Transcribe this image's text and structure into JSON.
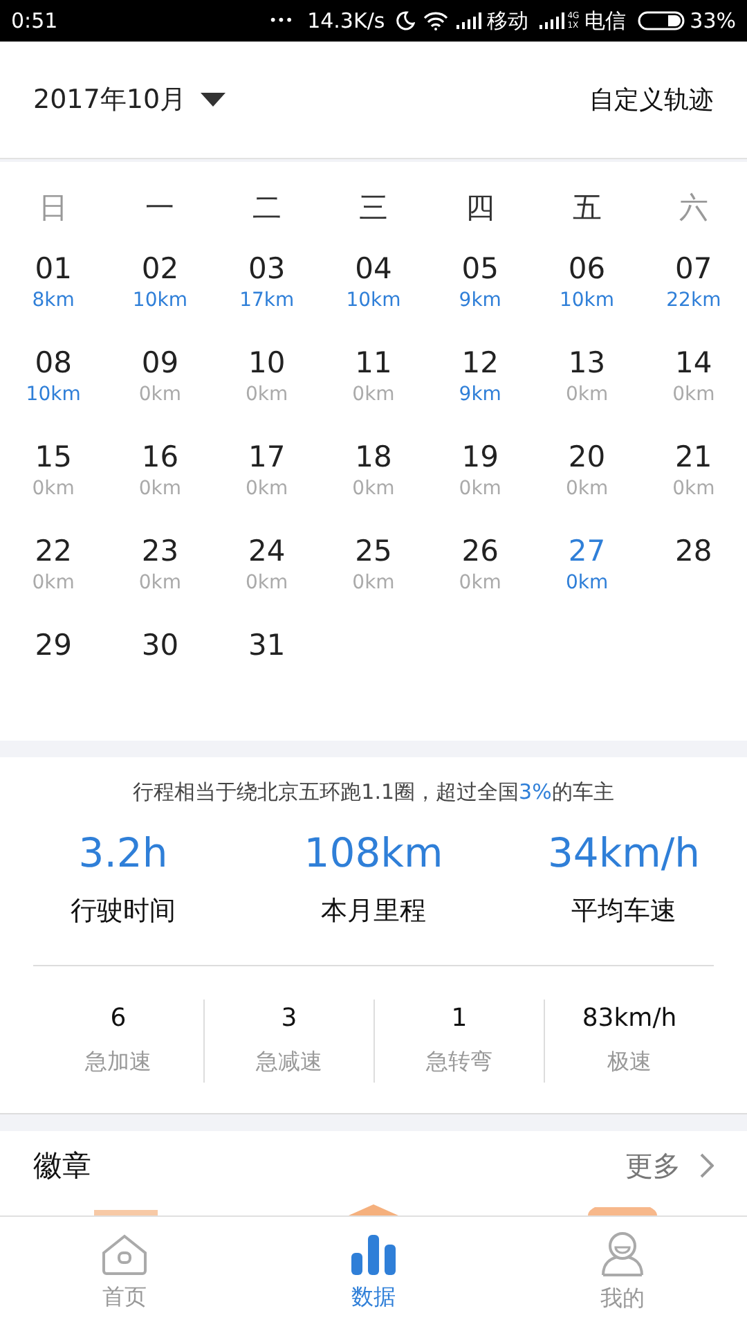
{
  "status_bar": {
    "time": "0:51",
    "dots": "•••",
    "speed": "14.3K/s",
    "carrier_1": "移动",
    "carrier_2": "电信",
    "net_type_top": "4G",
    "net_type_bottom": "1X",
    "battery": "33%"
  },
  "header": {
    "month": "2017年10月",
    "action": "自定义轨迹"
  },
  "weekdays": [
    {
      "label": "日",
      "weekend": true
    },
    {
      "label": "一",
      "weekend": false
    },
    {
      "label": "二",
      "weekend": false
    },
    {
      "label": "三",
      "weekend": false
    },
    {
      "label": "四",
      "weekend": false
    },
    {
      "label": "五",
      "weekend": false
    },
    {
      "label": "六",
      "weekend": true
    }
  ],
  "days": [
    {
      "day": "01",
      "km": "8km",
      "active": true,
      "today": false
    },
    {
      "day": "02",
      "km": "10km",
      "active": true,
      "today": false
    },
    {
      "day": "03",
      "km": "17km",
      "active": true,
      "today": false
    },
    {
      "day": "04",
      "km": "10km",
      "active": true,
      "today": false
    },
    {
      "day": "05",
      "km": "9km",
      "active": true,
      "today": false
    },
    {
      "day": "06",
      "km": "10km",
      "active": true,
      "today": false
    },
    {
      "day": "07",
      "km": "22km",
      "active": true,
      "today": false
    },
    {
      "day": "08",
      "km": "10km",
      "active": true,
      "today": false
    },
    {
      "day": "09",
      "km": "0km",
      "active": false,
      "today": false
    },
    {
      "day": "10",
      "km": "0km",
      "active": false,
      "today": false
    },
    {
      "day": "11",
      "km": "0km",
      "active": false,
      "today": false
    },
    {
      "day": "12",
      "km": "9km",
      "active": true,
      "today": false
    },
    {
      "day": "13",
      "km": "0km",
      "active": false,
      "today": false
    },
    {
      "day": "14",
      "km": "0km",
      "active": false,
      "today": false
    },
    {
      "day": "15",
      "km": "0km",
      "active": false,
      "today": false
    },
    {
      "day": "16",
      "km": "0km",
      "active": false,
      "today": false
    },
    {
      "day": "17",
      "km": "0km",
      "active": false,
      "today": false
    },
    {
      "day": "18",
      "km": "0km",
      "active": false,
      "today": false
    },
    {
      "day": "19",
      "km": "0km",
      "active": false,
      "today": false
    },
    {
      "day": "20",
      "km": "0km",
      "active": false,
      "today": false
    },
    {
      "day": "21",
      "km": "0km",
      "active": false,
      "today": false
    },
    {
      "day": "22",
      "km": "0km",
      "active": false,
      "today": false
    },
    {
      "day": "23",
      "km": "0km",
      "active": false,
      "today": false
    },
    {
      "day": "24",
      "km": "0km",
      "active": false,
      "today": false
    },
    {
      "day": "25",
      "km": "0km",
      "active": false,
      "today": false
    },
    {
      "day": "26",
      "km": "0km",
      "active": false,
      "today": false
    },
    {
      "day": "27",
      "km": "0km",
      "active": true,
      "today": true
    },
    {
      "day": "28",
      "today": false
    },
    {
      "day": "29",
      "today": false
    },
    {
      "day": "30",
      "today": false
    },
    {
      "day": "31",
      "today": false
    }
  ],
  "summary": {
    "highlight": "3%",
    "text_before": "行程相当于绕北京五环跑1.1圈，超过全国",
    "text_after": "的车主"
  },
  "main_stats": [
    {
      "value": "3.2h",
      "label": "行驶时间"
    },
    {
      "value": "108km",
      "label": "本月里程"
    },
    {
      "value": "34km/h",
      "label": "平均车速"
    }
  ],
  "minor_stats": [
    {
      "value": "6",
      "label": "急加速"
    },
    {
      "value": "3",
      "label": "急减速"
    },
    {
      "value": "1",
      "label": "急转弯"
    },
    {
      "value": "83km/h",
      "label": "极速"
    }
  ],
  "badges": {
    "title": "徽章",
    "more": "更多"
  },
  "tabs": [
    {
      "label": "首页",
      "kind": "home",
      "selected": false
    },
    {
      "label": "数据",
      "kind": "chart",
      "selected": true
    },
    {
      "label": "我的",
      "kind": "user",
      "selected": false
    }
  ]
}
